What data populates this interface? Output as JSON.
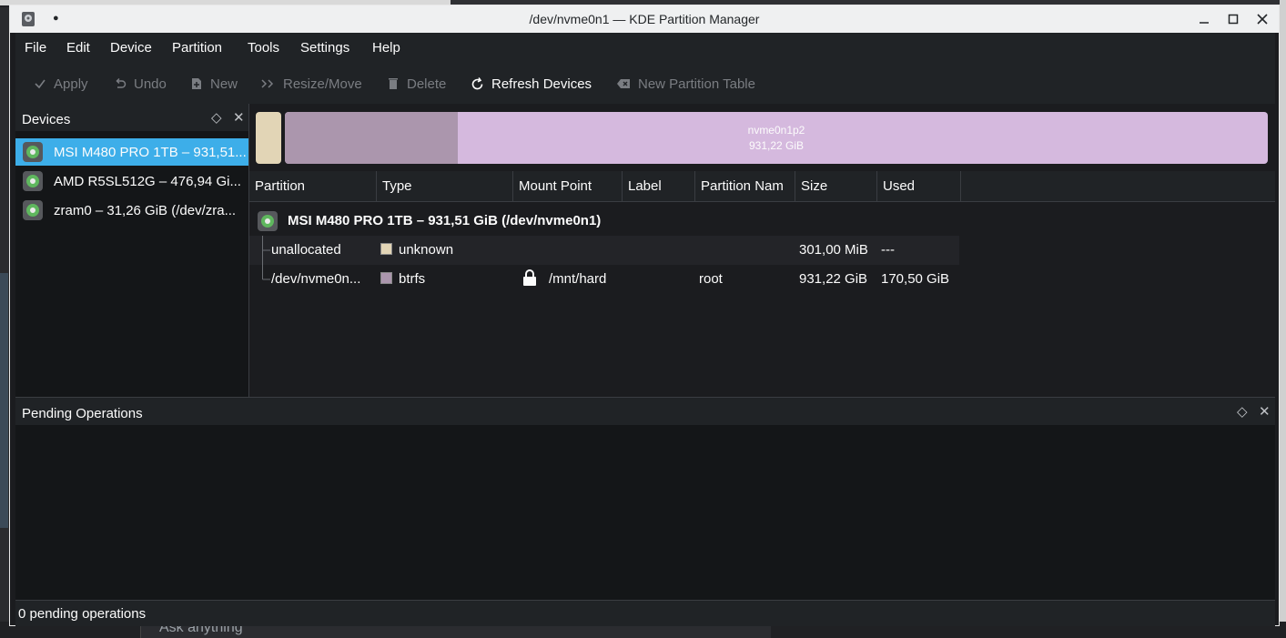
{
  "window": {
    "title": "/dev/nvme0n1 — KDE Partition Manager"
  },
  "menubar": [
    "File",
    "Edit",
    "Device",
    "Partition",
    "Tools",
    "Settings",
    "Help"
  ],
  "toolbar": {
    "apply": "Apply",
    "undo": "Undo",
    "new": "New",
    "resize_move": "Resize/Move",
    "delete": "Delete",
    "refresh": "Refresh Devices",
    "new_table": "New Partition Table"
  },
  "devices": {
    "title": "Devices",
    "items": [
      {
        "label": "MSI M480 PRO 1TB – 931,51...",
        "selected": true
      },
      {
        "label": "AMD R5SL512G – 476,94 Gi...",
        "selected": false
      },
      {
        "label": "zram0 – 31,26 GiB (/dev/zra...",
        "selected": false
      }
    ]
  },
  "partition_bar": {
    "name": "nvme0n1p2",
    "size": "931,22 GiB"
  },
  "table": {
    "columns": [
      "Partition",
      "Type",
      "Mount Point",
      "Label",
      "Partition Nam",
      "Size",
      "Used"
    ],
    "device_row": "MSI M480 PRO 1TB – 931,51 GiB (/dev/nvme0n1)",
    "rows": [
      {
        "partition": "unallocated",
        "type": "unknown",
        "type_color": "#e2d5b6",
        "mount": "",
        "label": "",
        "partition_name": "",
        "size": "301,00 MiB",
        "used": "---"
      },
      {
        "partition": "/dev/nvme0n...",
        "type": "btrfs",
        "type_color": "#ab96ad",
        "mount": "/mnt/hard",
        "label": "",
        "partition_name": "root",
        "size": "931,22 GiB",
        "used": "170,50 GiB"
      }
    ]
  },
  "pending": {
    "title": "Pending Operations",
    "status": "0 pending operations"
  },
  "background": {
    "ask_placeholder": "Ask anything"
  }
}
